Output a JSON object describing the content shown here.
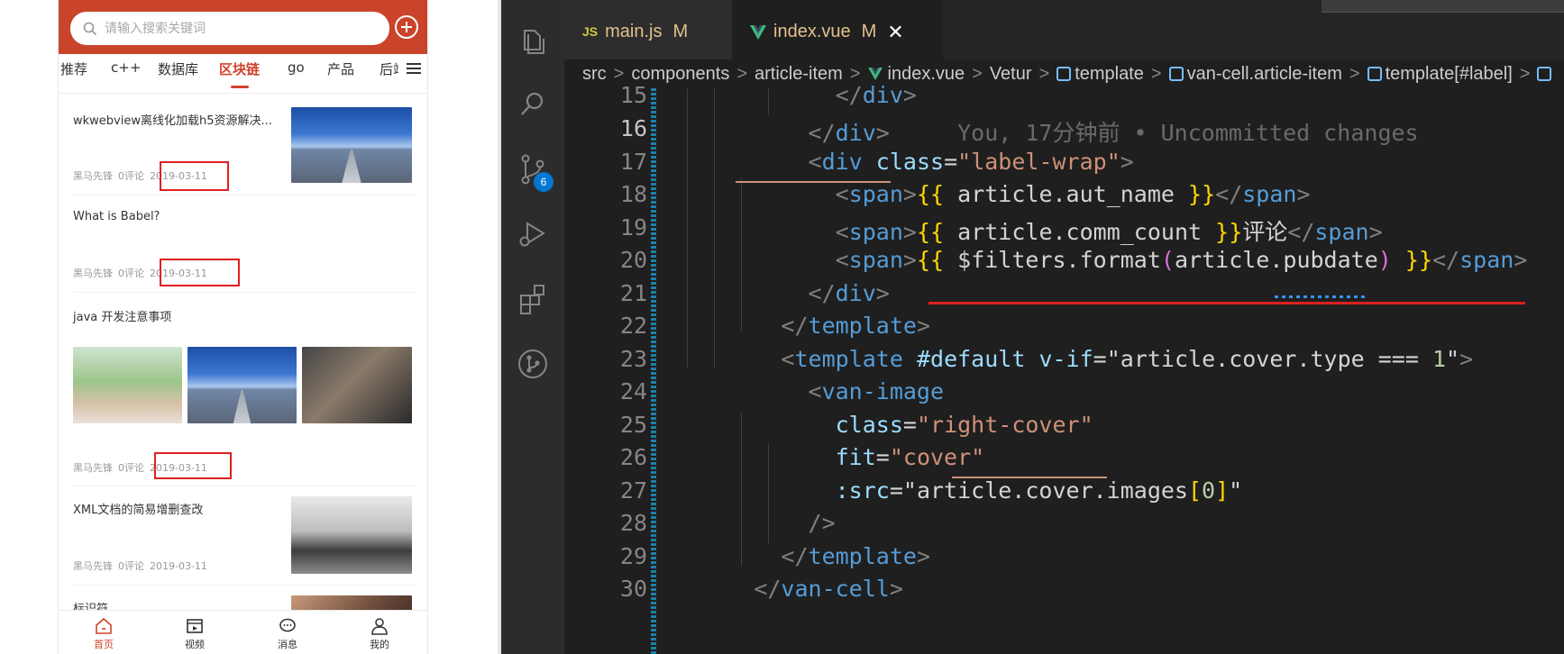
{
  "mobile": {
    "search_placeholder": "请输入搜索关键词",
    "tabs": [
      "推荐",
      "c++",
      "数据库",
      "区块链",
      "go",
      "产品",
      "后端"
    ],
    "active_tab": "区块链",
    "articles": [
      {
        "title": "wkwebview离线化加载h5资源解决...",
        "author": "黑马先锋",
        "comments": "0评论",
        "date": "2019-03-11"
      },
      {
        "title": "What is Babel?",
        "author": "黑马先锋",
        "comments": "0评论",
        "date": "2019-03-11"
      },
      {
        "title": "java 开发注意事项",
        "author": "黑马先锋",
        "comments": "0评论",
        "date": "2019-03-11"
      },
      {
        "title": "XML文档的简易增删查改",
        "author": "黑马先锋",
        "comments": "0评论",
        "date": "2019-03-11"
      },
      {
        "title": "标识符"
      }
    ],
    "tabbar": [
      "首页",
      "视频",
      "消息",
      "我的"
    ]
  },
  "vscode": {
    "tabs": [
      {
        "badge": "JS",
        "name": "main.js",
        "status": "M"
      },
      {
        "name": "index.vue",
        "status": "M"
      }
    ],
    "scm_badge": "6",
    "breadcrumb": [
      "src",
      "components",
      "article-item",
      "index.vue",
      "Vetur",
      "template",
      "van-cell.article-item",
      "template[#label]"
    ],
    "line_numbers": [
      "15",
      "16",
      "17",
      "18",
      "19",
      "20",
      "21",
      "22",
      "23",
      "24",
      "25",
      "26",
      "27",
      "28",
      "29",
      "30"
    ],
    "current_line": "16",
    "blame": "You, 17分钟前 • Uncommitted changes",
    "code": {
      "l17_class": "label-wrap",
      "l18_expr": "article.aut_name",
      "l19_expr": "article.comm_count",
      "l19_suffix": "评论",
      "l20_filter": "$filters.format",
      "l20_arg": "article.",
      "l20_arg2": "pubdate",
      "l23_slot": "#default",
      "l23_cond": "article.cover.type === ",
      "l23_num": "1",
      "l25_val": "right-cover",
      "l26_val": "cover",
      "l27_val": "article.cover.images",
      "l27_idx": "0"
    }
  }
}
